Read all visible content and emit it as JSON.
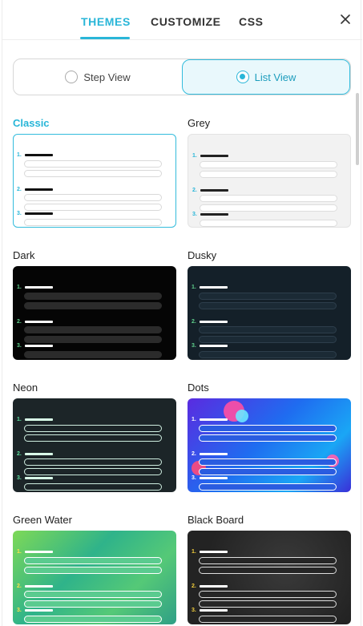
{
  "tabs": [
    {
      "label": "THEMES",
      "active": true
    },
    {
      "label": "CUSTOMIZE",
      "active": false
    },
    {
      "label": "CSS",
      "active": false
    }
  ],
  "close_icon": "close-icon",
  "view_toggle": {
    "step_label": "Step View",
    "list_label": "List View",
    "selected": "List View"
  },
  "themes": [
    {
      "name": "Classic",
      "selected": true,
      "bg": "#ffffff",
      "num": "#29b6d8",
      "bar": "#111111",
      "opt_fill": "#ffffff",
      "opt_border": "#d9d9d9"
    },
    {
      "name": "Grey",
      "selected": false,
      "bg": "#f2f2f2",
      "num": "#29b6d8",
      "bar": "#222222",
      "opt_fill": "#ffffff",
      "opt_border": "#dddddd"
    },
    {
      "name": "Dark",
      "selected": false,
      "bg": "#050505",
      "num": "#5fd18c",
      "bar": "#ffffff",
      "opt_fill": "#2b2b2b",
      "opt_border": "#2b2b2b"
    },
    {
      "name": "Dusky",
      "selected": false,
      "bg": "#142029",
      "num": "#5fd18c",
      "bar": "#ffffff",
      "opt_fill": "#1b2a35",
      "opt_border": "#2d3e4b"
    },
    {
      "name": "Neon",
      "selected": false,
      "bg": "#1c2528",
      "num": "#5fe0a0",
      "bar": "#d9ffe9",
      "opt_fill": "#1c2528",
      "opt_border": "#cfeee0"
    },
    {
      "name": "Dots",
      "selected": false,
      "bg": "#1f4fd8",
      "num": "#ffffff",
      "bar": "#ffffff",
      "opt_fill": "#2a5ce0",
      "opt_border": "#ffffff"
    },
    {
      "name": "Green Water",
      "selected": false,
      "bg": "#3cbf7c",
      "num": "#ffe14a",
      "bar": "#ffffff",
      "opt_fill": "#5acb8f",
      "opt_border": "#ffffff"
    },
    {
      "name": "Black Board",
      "selected": false,
      "bg": "#262626",
      "num": "#f5d03b",
      "bar": "#ffffff",
      "opt_fill": "#262626",
      "opt_border": "#dddddd"
    }
  ],
  "question_numbers": [
    "1.",
    "2.",
    "3."
  ],
  "colors": {
    "accent": "#29b6d8"
  }
}
